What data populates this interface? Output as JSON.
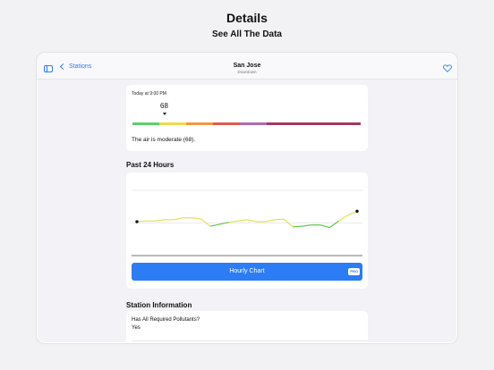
{
  "hero": {
    "title": "Details",
    "subtitle": "See All The Data"
  },
  "nav": {
    "back_label": "Stations",
    "title": "San Jose",
    "subtitle": "Downtown"
  },
  "air_quality": {
    "timestamp": "Today at 9:00 PM",
    "value": "68",
    "description": "The air is moderate (68).",
    "scale_colors": [
      "#5dcf6e",
      "#f2d84e",
      "#f09a42",
      "#e05a4e",
      "#b06ab0",
      "#a03a5a"
    ],
    "scale_weights": [
      30,
      30,
      30,
      30,
      30,
      105
    ]
  },
  "past_24": {
    "title": "Past 24 Hours",
    "button_label": "Hourly Chart",
    "badge": "PRO",
    "threshold_value": 50,
    "colors": {
      "above": "#e6e45a",
      "below": "#6bc95a"
    }
  },
  "chart_data": {
    "type": "line",
    "title": "",
    "xlabel": "",
    "ylabel": "",
    "x": [
      0,
      1,
      2,
      3,
      4,
      5,
      6,
      7,
      8,
      9,
      10,
      11,
      12,
      13,
      14,
      15,
      16,
      17,
      18,
      19,
      20,
      21,
      22,
      23,
      24
    ],
    "values": [
      52,
      53,
      53,
      55,
      55,
      58,
      58,
      56,
      45,
      48,
      51,
      53,
      55,
      52,
      52,
      55,
      56,
      44,
      45,
      47,
      47,
      43,
      53,
      62,
      68
    ],
    "ylim": [
      0,
      100
    ]
  },
  "station_info": {
    "title": "Station Information",
    "label": "Has All Required Pollutants?",
    "value": "Yes"
  }
}
